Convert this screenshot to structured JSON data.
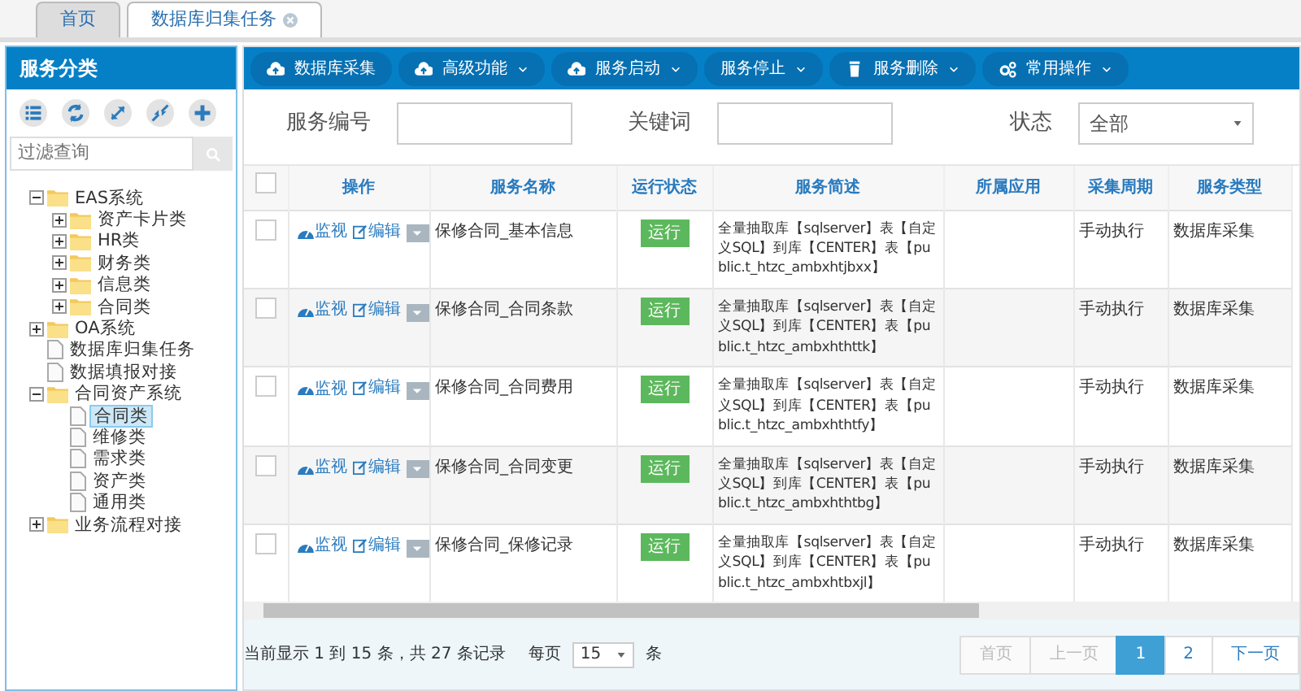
{
  "tabs": [
    {
      "label": "首页",
      "selected": false,
      "closable": false
    },
    {
      "label": "数据库归集任务",
      "selected": true,
      "closable": true
    }
  ],
  "sidebar": {
    "title": "服务分类",
    "filter": {
      "placeholder": "过滤查询"
    },
    "tree": [
      {
        "label": "EAS系统",
        "kind": "folder",
        "expanded": true,
        "selected": false,
        "children": [
          {
            "label": "资产卡片类",
            "kind": "folder",
            "expanded": false,
            "selected": false
          },
          {
            "label": "HR类",
            "kind": "folder",
            "expanded": false,
            "selected": false
          },
          {
            "label": "财务类",
            "kind": "folder",
            "expanded": false,
            "selected": false
          },
          {
            "label": "信息类",
            "kind": "folder",
            "expanded": false,
            "selected": false
          },
          {
            "label": "合同类",
            "kind": "folder",
            "expanded": false,
            "selected": false
          }
        ]
      },
      {
        "label": "OA系统",
        "kind": "folder",
        "expanded": false,
        "selected": false
      },
      {
        "label": "数据库归集任务",
        "kind": "file",
        "selected": false
      },
      {
        "label": "数据填报对接",
        "kind": "file",
        "selected": false
      },
      {
        "label": "合同资产系统",
        "kind": "folder",
        "expanded": true,
        "selected": false,
        "children": [
          {
            "label": "合同类",
            "kind": "file",
            "selected": true
          },
          {
            "label": "维修类",
            "kind": "file",
            "selected": false
          },
          {
            "label": "需求类",
            "kind": "file",
            "selected": false
          },
          {
            "label": "资产类",
            "kind": "file",
            "selected": false
          },
          {
            "label": "通用类",
            "kind": "file",
            "selected": false
          }
        ]
      },
      {
        "label": "业务流程对接",
        "kind": "folder",
        "expanded": false,
        "selected": false
      }
    ]
  },
  "toolbar": [
    {
      "label": "数据库采集",
      "dropdown": false
    },
    {
      "label": "高级功能",
      "dropdown": true
    },
    {
      "label": "服务启动",
      "dropdown": true
    },
    {
      "label": "服务停止",
      "dropdown": true
    },
    {
      "label": "服务删除",
      "dropdown": true
    },
    {
      "label": "常用操作",
      "dropdown": true
    }
  ],
  "search": [
    {
      "label": "服务编号",
      "kind": "text"
    },
    {
      "label": "关键词",
      "kind": "text"
    },
    {
      "label": "状态",
      "kind": "select",
      "value": "全部"
    }
  ],
  "table": {
    "select_all_checked": false,
    "columns": [
      "操作",
      "服务名称",
      "运行状态",
      "服务简述",
      "所属应用",
      "采集周期",
      "服务类型"
    ],
    "rows": [
      {
        "checked": false,
        "actions": [
          "监视",
          "编辑"
        ],
        "name": "保修合同_基本信息",
        "status": "运行",
        "description": "全量抽取库【sqlserver】表【自定义SQL】到库【CENTER】表【public.t_htzc_ambxhtjbxx】",
        "cycle": "手动执行",
        "type": "数据库采集"
      },
      {
        "checked": false,
        "actions": [
          "监视",
          "编辑"
        ],
        "name": "保修合同_合同条款",
        "status": "运行",
        "description": "全量抽取库【sqlserver】表【自定义SQL】到库【CENTER】表【public.t_htzc_ambxhthttk】",
        "cycle": "手动执行",
        "type": "数据库采集"
      },
      {
        "checked": false,
        "actions": [
          "监视",
          "编辑"
        ],
        "name": "保修合同_合同费用",
        "status": "运行",
        "description": "全量抽取库【sqlserver】表【自定义SQL】到库【CENTER】表【public.t_htzc_ambxhthtfy】",
        "cycle": "手动执行",
        "type": "数据库采集"
      },
      {
        "checked": false,
        "actions": [
          "监视",
          "编辑"
        ],
        "name": "保修合同_合同变更",
        "status": "运行",
        "description": "全量抽取库【sqlserver】表【自定义SQL】到库【CENTER】表【public.t_htzc_ambxhthtbg】",
        "cycle": "手动执行",
        "type": "数据库采集"
      },
      {
        "checked": false,
        "actions": [
          "监视",
          "编辑"
        ],
        "name": "保修合同_保修记录",
        "status": "运行",
        "description": "全量抽取库【sqlserver】表【自定义SQL】到库【CENTER】表【public.t_htzc_ambxhtbxjl】",
        "cycle": "手动执行",
        "type": "数据库采集"
      }
    ]
  },
  "footer": {
    "summary": "当前显示 1 到 15 条，共 27 条记录",
    "per_page_label": "每页",
    "per_page": "15",
    "per_page_unit": "条",
    "pages": [
      {
        "label": "首页",
        "disabled": true,
        "selected": false
      },
      {
        "label": "上一页",
        "disabled": true,
        "selected": false
      },
      {
        "label": "1",
        "disabled": false,
        "selected": true
      },
      {
        "label": "2",
        "disabled": false,
        "selected": false
      },
      {
        "label": "下一页",
        "disabled": false,
        "selected": false
      }
    ]
  }
}
